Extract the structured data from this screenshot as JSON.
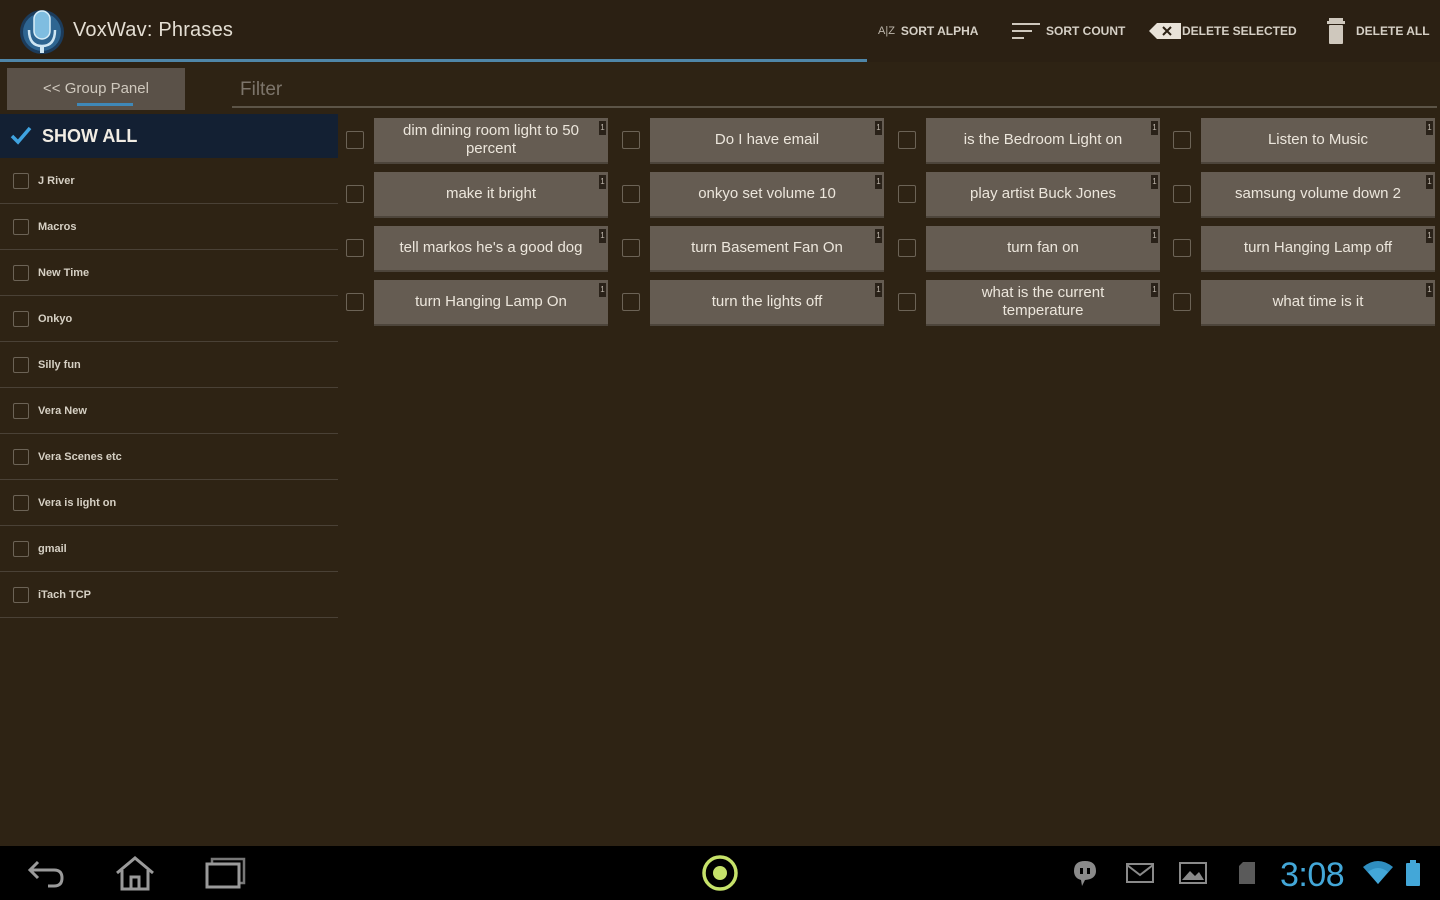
{
  "app": {
    "title": "VoxWav: Phrases",
    "icon": "microphone-icon"
  },
  "progress": {
    "fraction": 0.602,
    "color": "#4f86a8"
  },
  "toolbar": {
    "actions": [
      {
        "label": "SORT ALPHA",
        "icon": "sort-alpha-icon",
        "icon_text": "A|Z"
      },
      {
        "label": "SORT COUNT",
        "icon": "sort-count-icon"
      },
      {
        "label": "DELETE SELECTED",
        "icon": "backspace-icon"
      },
      {
        "label": "DELETE ALL",
        "icon": "trash-icon"
      }
    ]
  },
  "group_panel": {
    "toggle_label": "<< Group Panel"
  },
  "filter": {
    "placeholder": "Filter",
    "value": ""
  },
  "groups": {
    "show_all": {
      "label": "SHOW ALL",
      "checked": true
    },
    "items": [
      {
        "label": "J River"
      },
      {
        "label": "Macros"
      },
      {
        "label": "New Time"
      },
      {
        "label": "Onkyo"
      },
      {
        "label": "Silly fun"
      },
      {
        "label": "Vera New"
      },
      {
        "label": "Vera Scenes etc"
      },
      {
        "label": "Vera is light on"
      },
      {
        "label": "gmail"
      },
      {
        "label": "iTach TCP"
      }
    ]
  },
  "phrases": [
    {
      "text": "dim dining room light to 50 percent",
      "count": "1"
    },
    {
      "text": "Do I have email",
      "count": "1"
    },
    {
      "text": "is the Bedroom Light on",
      "count": "1"
    },
    {
      "text": "Listen to Music",
      "count": "1"
    },
    {
      "text": "make it bright",
      "count": "1"
    },
    {
      "text": "onkyo set volume 10",
      "count": "1"
    },
    {
      "text": "play artist Buck Jones",
      "count": "1"
    },
    {
      "text": "samsung volume down 2",
      "count": "1"
    },
    {
      "text": "tell markos he's a good dog",
      "count": "1"
    },
    {
      "text": "turn Basement Fan On",
      "count": "1"
    },
    {
      "text": "turn fan on",
      "count": "1"
    },
    {
      "text": "turn Hanging Lamp off",
      "count": "1"
    },
    {
      "text": "turn Hanging Lamp On",
      "count": "1"
    },
    {
      "text": "turn the lights off",
      "count": "1"
    },
    {
      "text": "what is the current temperature",
      "count": "1"
    },
    {
      "text": "what time is it",
      "count": "1"
    }
  ],
  "system_bar": {
    "nav": [
      {
        "icon": "back-icon"
      },
      {
        "icon": "home-icon"
      },
      {
        "icon": "recent-apps-icon"
      }
    ],
    "center_icon": "record-indicator-icon",
    "status_icons": [
      "talk-icon",
      "mail-icon",
      "gallery-icon",
      "sd-card-icon"
    ],
    "time": "3:08",
    "wifi_icon": "wifi-icon",
    "battery_icon": "battery-icon",
    "accent": "#43a7d8"
  }
}
